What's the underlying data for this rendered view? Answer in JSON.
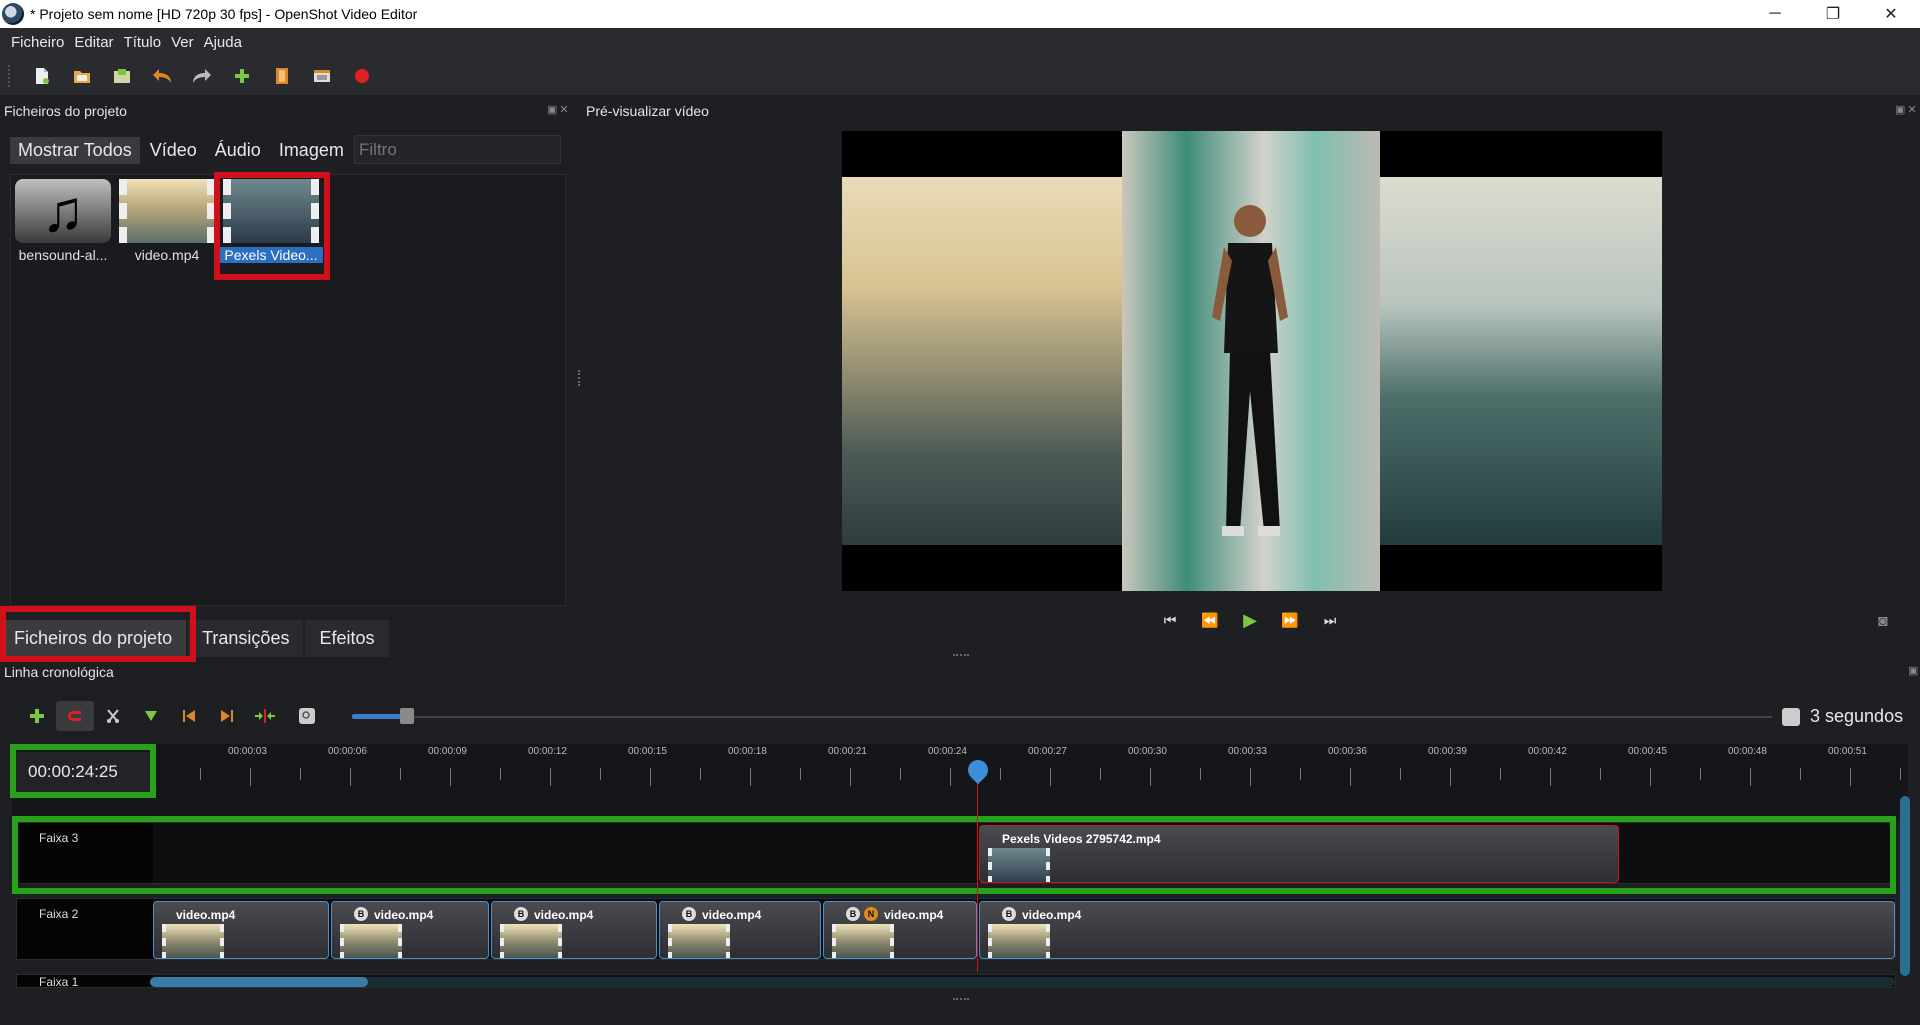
{
  "window": {
    "title": "* Projeto sem nome [HD 720p 30 fps] - OpenShot Video Editor",
    "minimize": "─",
    "restore": "❐",
    "close": "✕"
  },
  "menu": [
    "Ficheiro",
    "Editar",
    "Título",
    "Ver",
    "Ajuda"
  ],
  "toolbar": {
    "icons": [
      "new-project-icon",
      "open-project-icon",
      "save-project-icon",
      "undo-icon",
      "redo-icon",
      "import-files-icon",
      "choose-profile-icon",
      "fullscreen-icon",
      "export-video-icon"
    ]
  },
  "project_files": {
    "title": "Ficheiros do projeto",
    "filters": [
      "Mostrar Todos",
      "Vídeo",
      "Áudio",
      "Imagem"
    ],
    "filter_placeholder": "Filtro",
    "files": [
      {
        "name": "bensound-al...",
        "type": "audio"
      },
      {
        "name": "video.mp4",
        "type": "video"
      },
      {
        "name": "Pexels Video...",
        "type": "video",
        "selected": true
      }
    ]
  },
  "left_tabs": [
    "Ficheiros do projeto",
    "Transições",
    "Efeitos"
  ],
  "preview": {
    "title": "Pré-visualizar vídeo",
    "controls": [
      "⏮",
      "⏪",
      "▶",
      "⏩",
      "⏭"
    ]
  },
  "timeline": {
    "title": "Linha cronológica",
    "timecode": "00:00:24:25",
    "zoom_label": "3 segundos",
    "zoom_level": 0.04,
    "ruler_labels": [
      "00:00:03",
      "00:00:06",
      "00:00:09",
      "00:00:12",
      "00:00:15",
      "00:00:18",
      "00:00:21",
      "00:00:24",
      "00:00:27",
      "00:00:30",
      "00:00:33",
      "00:00:36",
      "00:00:39",
      "00:00:42",
      "00:00:45",
      "00:00:48",
      "00:00:51"
    ],
    "tracks": [
      {
        "name": "Faixa 3",
        "clips": [
          {
            "name": "Pexels Videos 2795742.mp4",
            "badges": []
          }
        ]
      },
      {
        "name": "Faixa 2",
        "clips": [
          {
            "name": "video.mp4",
            "badges": []
          },
          {
            "name": "video.mp4",
            "badges": [
              "B"
            ]
          },
          {
            "name": "video.mp4",
            "badges": [
              "B"
            ]
          },
          {
            "name": "video.mp4",
            "badges": [
              "B"
            ]
          },
          {
            "name": "video.mp4",
            "badges": [
              "B",
              "N"
            ]
          },
          {
            "name": "video.mp4",
            "badges": [
              "B"
            ]
          }
        ]
      },
      {
        "name": "Faixa 1",
        "clips": []
      }
    ]
  },
  "colors": {
    "highlight_red": "#d0101a",
    "highlight_green": "#27a31a",
    "accent_blue": "#3a7cc8"
  }
}
